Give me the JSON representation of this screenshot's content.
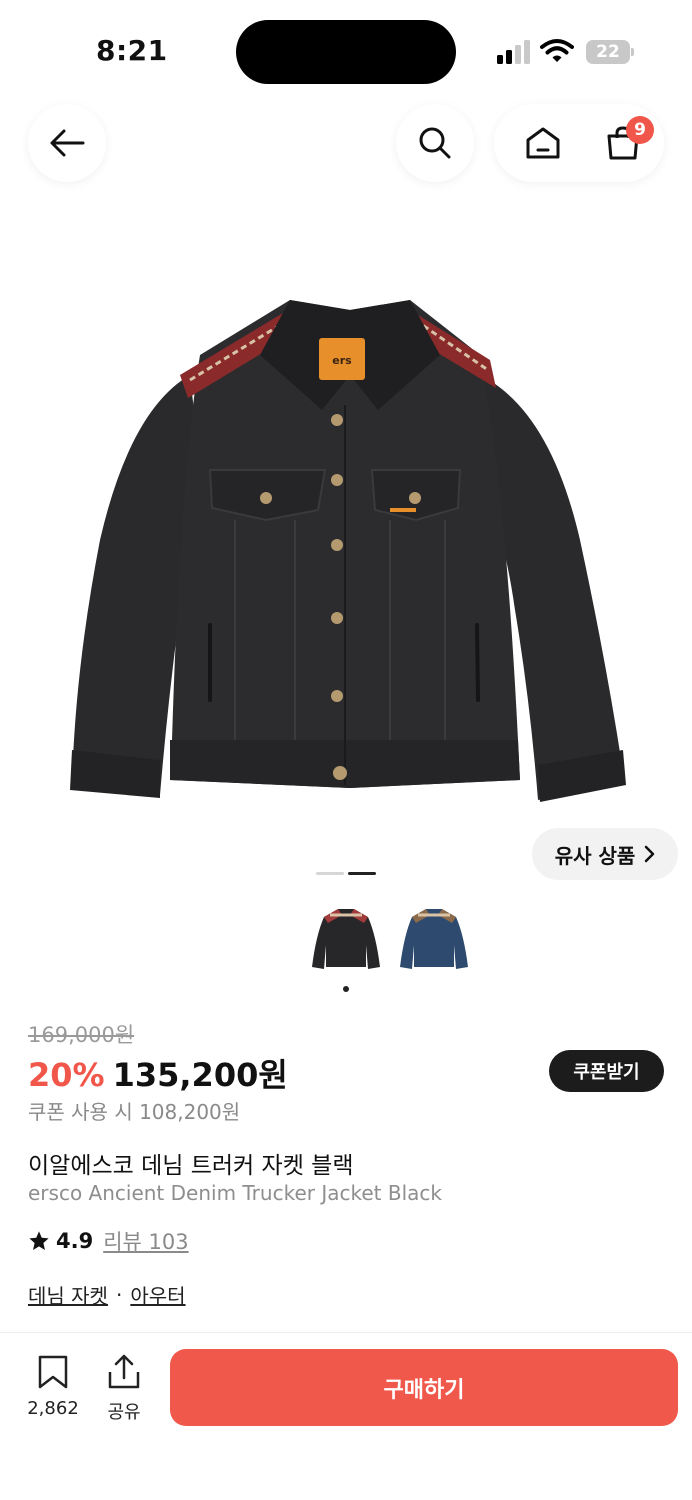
{
  "status_bar": {
    "time": "8:21",
    "battery": "22"
  },
  "nav": {
    "cart_count": "9"
  },
  "gallery": {
    "similar_label": "유사 상품",
    "thumbnails": [
      "black",
      "blue"
    ]
  },
  "product": {
    "original_price": "169,000원",
    "discount": "20%",
    "price": "135,200원",
    "coupon_button": "쿠폰받기",
    "coupon_price": "쿠폰 사용 시 108,200원",
    "title_ko": "이알에스코 데님 트러커 자켓 블랙",
    "title_en": "ersco Ancient Denim Trucker Jacket Black",
    "rating": "4.9",
    "review_label": "리뷰 103",
    "categories": [
      "데님 자켓",
      "아우터"
    ],
    "category_separator": "·"
  },
  "bottom_bar": {
    "bookmark_count": "2,862",
    "share_label": "공유",
    "buy_label": "구매하기"
  },
  "colors": {
    "accent": "#f0574a",
    "dark": "#1c1c1c"
  }
}
